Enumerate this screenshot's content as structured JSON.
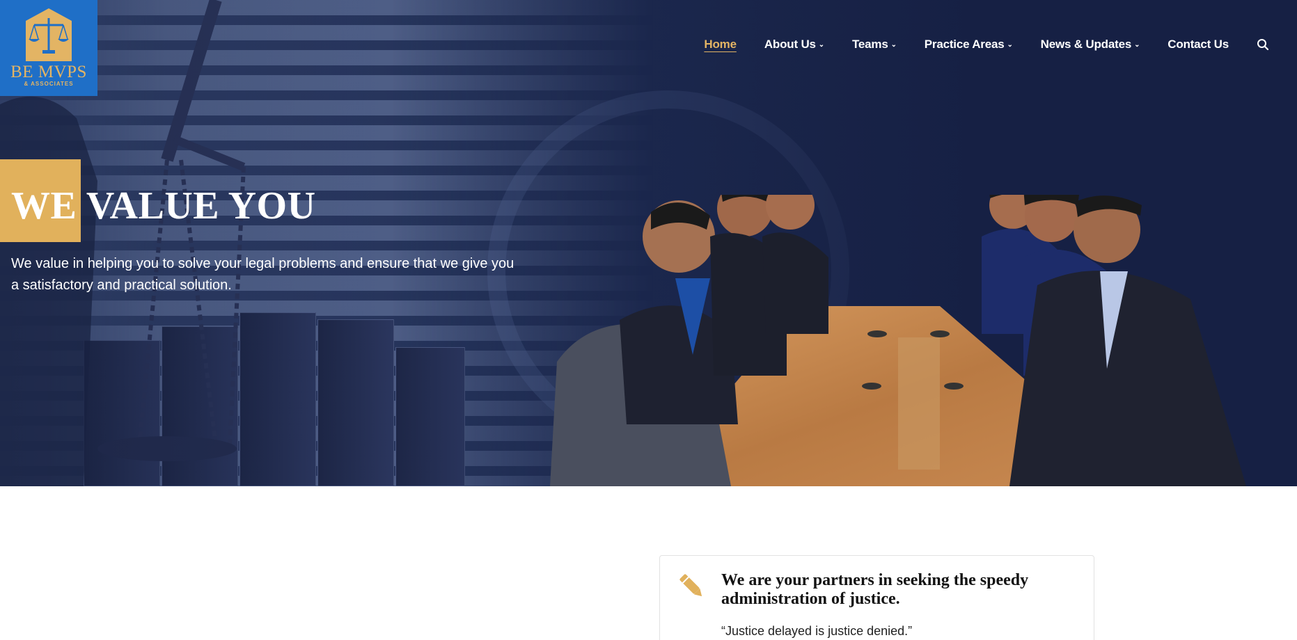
{
  "logo": {
    "name": "BE MVPS",
    "sub": "& ASSOCIATES",
    "bg": "#1f6fc7",
    "accent": "#e3b464"
  },
  "nav": {
    "items": [
      {
        "label": "Home",
        "active": true,
        "dropdown": false
      },
      {
        "label": "About Us",
        "active": false,
        "dropdown": true
      },
      {
        "label": "Teams",
        "active": false,
        "dropdown": true
      },
      {
        "label": "Practice Areas",
        "active": false,
        "dropdown": true
      },
      {
        "label": "News & Updates",
        "active": false,
        "dropdown": true
      },
      {
        "label": "Contact Us",
        "active": false,
        "dropdown": false
      }
    ],
    "search_icon": "search-icon"
  },
  "hero": {
    "headline": "WE VALUE YOU",
    "subhead": "We value in helping you to solve your legal problems and ensure that we give you a satisfactory and practical solution.",
    "accent": "#e1b15c",
    "background": "#1a2550"
  },
  "card": {
    "icon": "pencil-icon",
    "title": "We are your partners in seeking the speedy administration of justice.",
    "quote": "“Justice delayed is justice denied.”"
  }
}
